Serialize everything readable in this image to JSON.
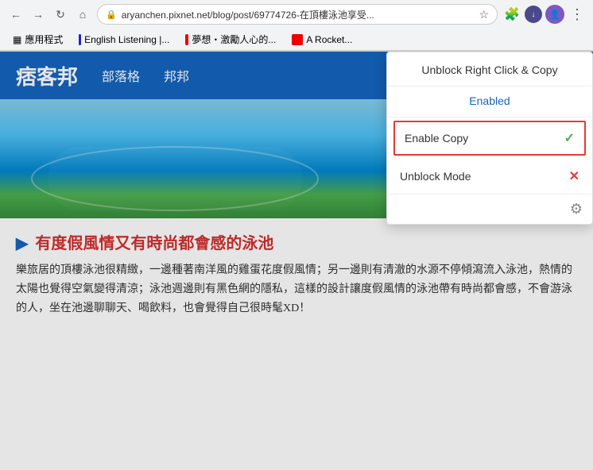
{
  "browser": {
    "url": "aryanchen.pixnet.net/blog/post/69774726-在頂樓泳池享受...",
    "back_disabled": false,
    "forward_disabled": true
  },
  "bookmarks": [
    {
      "label": "應用程式",
      "icon": "▦"
    },
    {
      "label": "English Listening |...",
      "icon": "🎧"
    },
    {
      "label": "夢想・激勵人心的...",
      "icon": "▶"
    },
    {
      "label": "A Rocket...",
      "icon": "▶"
    }
  ],
  "blog": {
    "logo": "痞客邦",
    "nav": [
      "部落格",
      "邦邦"
    ],
    "hero_article_title": "有度假風情又有時尚都會感的泳池",
    "article_text": "樂旅居的頂樓泳池很精緻，一邊種著南洋風的雞蛋花度假風情；另一邊則有清澈的水源不停傾瀉流入泳池，熱情的太陽也覺得空氣變得清涼；泳池週邊則有黑色網的隱私，這樣的設計讓度假風情的泳池帶有時尚都會感，不會游泳的人，坐在池邊聊聊天、喝飲料，也會覺得自己很時髦XD！"
  },
  "popup": {
    "title": "Unblock Right Click & Copy",
    "status_label": "Enabled",
    "menu_items": [
      {
        "label": "Enable Copy",
        "icon_type": "check",
        "highlighted": true
      },
      {
        "label": "Unblock Mode",
        "icon_type": "x",
        "highlighted": false
      }
    ],
    "gear_label": "⚙"
  }
}
